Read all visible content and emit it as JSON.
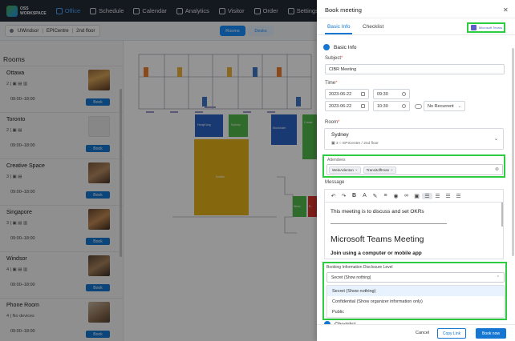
{
  "app": {
    "logo_line1": "OSS",
    "logo_line2": "WORKSPACE"
  },
  "nav": [
    {
      "label": "Office",
      "icon": "office-icon",
      "active": true
    },
    {
      "label": "Schedule",
      "icon": "schedule-icon",
      "active": false
    },
    {
      "label": "Calendar",
      "icon": "calendar-icon",
      "active": false
    },
    {
      "label": "Analytics",
      "icon": "analytics-icon",
      "active": false
    },
    {
      "label": "Visitor",
      "icon": "visitor-icon",
      "active": false
    },
    {
      "label": "Order",
      "icon": "order-icon",
      "active": false
    },
    {
      "label": "Settings",
      "icon": "settings-icon",
      "active": false
    }
  ],
  "breadcrumb": {
    "site": "UWindsor",
    "building": "EPICentre",
    "floor": "2nd floor"
  },
  "view_toggle": {
    "rooms": "Rooms",
    "desks": "Desks"
  },
  "rooms_panel": {
    "title": "Rooms",
    "book_label": "Book",
    "items": [
      {
        "name": "Ottawa",
        "meta": "2 | ▣ ▤ ▥",
        "hours": "09:00–18:00"
      },
      {
        "name": "Toronto",
        "meta": "2 | ▣ ▤",
        "hours": "09:00–18:00"
      },
      {
        "name": "Creative Space",
        "meta": "3 | ▣ ▤",
        "hours": "09:00–18:00"
      },
      {
        "name": "Singapore",
        "meta": "3 | ▣ ▤ ▥",
        "hours": "09:00–18:00"
      },
      {
        "name": "Windsor",
        "meta": "4 | ▣ ▤ ▥",
        "hours": "09:00–18:00"
      },
      {
        "name": "Phone Room",
        "meta": "4 | No devices",
        "hours": "09:00–18:00"
      },
      {
        "name": "",
        "meta": "",
        "hours": ""
      }
    ]
  },
  "floorplan": {
    "rooms": {
      "hongkong": "HongKong",
      "sydney": "Sydney",
      "stockholm": "Stockholm",
      "create": "Create",
      "seattle": "Seattle",
      "wind": "Wind...",
      "s": "S..."
    }
  },
  "drawer": {
    "title": "Book meeting",
    "tabs": {
      "basic": "Basic Info",
      "checklist": "Checklist"
    },
    "teams_badge": "Microsoft Teams",
    "basic_section": "Basic Info",
    "subject": {
      "label": "Subject",
      "value": "CIBR Meeting"
    },
    "time": {
      "label": "Time",
      "start_date": "2023-06-22",
      "start_time": "09:30",
      "end_date": "2023-06-22",
      "end_time": "10:30",
      "recurrence": "No Recurrent"
    },
    "room": {
      "label": "Room",
      "name": "Sydney",
      "meta": "▣ 3   ○ EPICentre / 2nd floor"
    },
    "attendees": {
      "label": "Attendees",
      "tags": [
        "WeleAdenton",
        "TransitoffIman"
      ]
    },
    "message": {
      "label": "Message",
      "line1": "This meeting is to discuss and set OKRs",
      "heading": "Microsoft Teams Meeting",
      "sub": "Join using a computer or mobile app"
    },
    "disclosure": {
      "label": "Booking Information Disclosure Level",
      "selected": "Secret (Show nothing)",
      "options": [
        "Secret (Show nothing)",
        "Confidential (Show organizer information only)",
        "Public"
      ]
    },
    "checklist_section": "Checklist",
    "footer": {
      "cancel": "Cancel",
      "copy": "Copy Link",
      "book": "Book now"
    }
  },
  "colors": {
    "primary": "#1677d2",
    "highlight": "#2ecc40",
    "nav_bg": "#232a36"
  }
}
